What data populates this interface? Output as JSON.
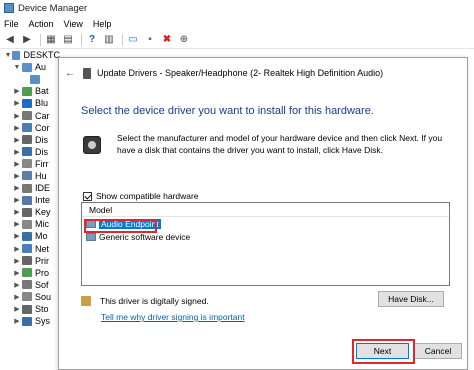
{
  "window": {
    "title": "Device Manager"
  },
  "menu": {
    "items": [
      "File",
      "Action",
      "View",
      "Help"
    ]
  },
  "tree": {
    "root": "DESKTC",
    "items": [
      {
        "label": "Au",
        "color": "#5b8fc7"
      },
      {
        "label": "",
        "color": "#5b8fc7"
      },
      {
        "label": "Bat",
        "color": "#4d9e4d"
      },
      {
        "label": "Blu",
        "color": "#1a6fc4"
      },
      {
        "label": "Car",
        "color": "#777777"
      },
      {
        "label": "Cor",
        "color": "#4a7fb5"
      },
      {
        "label": "Dis",
        "color": "#666666"
      },
      {
        "label": "Dis",
        "color": "#3a6ea5"
      },
      {
        "label": "Firr",
        "color": "#888888"
      },
      {
        "label": "Hu",
        "color": "#5a7fa8"
      },
      {
        "label": "IDE",
        "color": "#777777"
      },
      {
        "label": "Inte",
        "color": "#5577aa"
      },
      {
        "label": "Key",
        "color": "#666666"
      },
      {
        "label": "Mic",
        "color": "#888888"
      },
      {
        "label": "Mo",
        "color": "#3a6ea5"
      },
      {
        "label": "Net",
        "color": "#4a7fb5"
      },
      {
        "label": "Prir",
        "color": "#666666"
      },
      {
        "label": "Pro",
        "color": "#4d9e4d"
      },
      {
        "label": "Sof",
        "color": "#777777"
      },
      {
        "label": "Sou",
        "color": "#888888"
      },
      {
        "label": "Sto",
        "color": "#666666"
      },
      {
        "label": "Sys",
        "color": "#3a6ea5"
      }
    ]
  },
  "dialog": {
    "header_title": "Update Drivers - Speaker/Headphone (2- Realtek High Definition Audio)",
    "heading": "Select the device driver you want to install for this hardware.",
    "description": "Select the manufacturer and model of your hardware device and then click Next. If you have a disk that contains the driver you want to install, click Have Disk.",
    "show_compatible_label": "Show compatible hardware",
    "show_compatible_checked": true,
    "model_header": "Model",
    "models": [
      "Audio Endpoint",
      "Generic software device"
    ],
    "selected_model": "Audio Endpoint",
    "signed_text": "This driver is digitally signed.",
    "signing_link": "Tell me why driver signing is important",
    "have_disk_label": "Have Disk...",
    "next_label": "Next",
    "cancel_label": "Cancel"
  },
  "colors": {
    "accent": "#0078d7",
    "heading": "#1a3c8c",
    "highlight": "#e0262e",
    "link": "#0063b1"
  }
}
